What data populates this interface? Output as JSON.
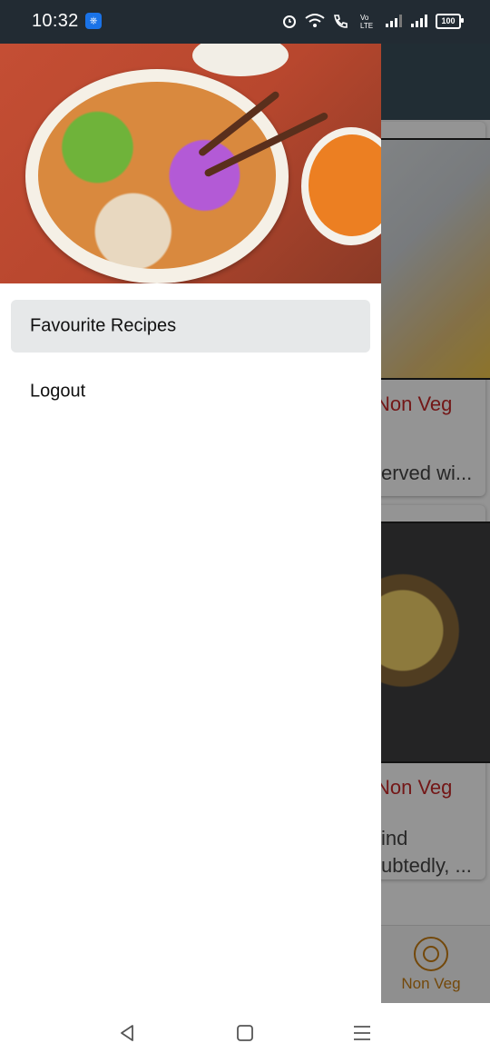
{
  "status_bar": {
    "time": "10:32",
    "battery": "100",
    "icons": [
      "usb-icon",
      "alarm-icon",
      "wifi-icon",
      "call-icon",
      "volte-icon",
      "signal-icon",
      "signal-icon",
      "battery-icon"
    ]
  },
  "background": {
    "cards": [
      {
        "tag": "Non Veg",
        "desc_lines": [
          "erved wi..."
        ]
      },
      {
        "tag": "Non Veg",
        "desc_lines": [
          "ind",
          "ubtedly, ..."
        ]
      }
    ],
    "bottom_nav": {
      "label": "Non Veg",
      "color": "#c77d12"
    }
  },
  "drawer": {
    "header_image": "noodle-bowl-photo",
    "menu": [
      {
        "label": "Favourite Recipes",
        "active": true
      },
      {
        "label": "Logout",
        "active": false
      }
    ]
  },
  "system_nav": {
    "buttons": [
      "back-icon",
      "home-icon",
      "recents-icon"
    ]
  },
  "colors": {
    "status_bar": "#222b33",
    "accent_red": "#c62828",
    "active_item_bg": "#e6e8e9"
  }
}
